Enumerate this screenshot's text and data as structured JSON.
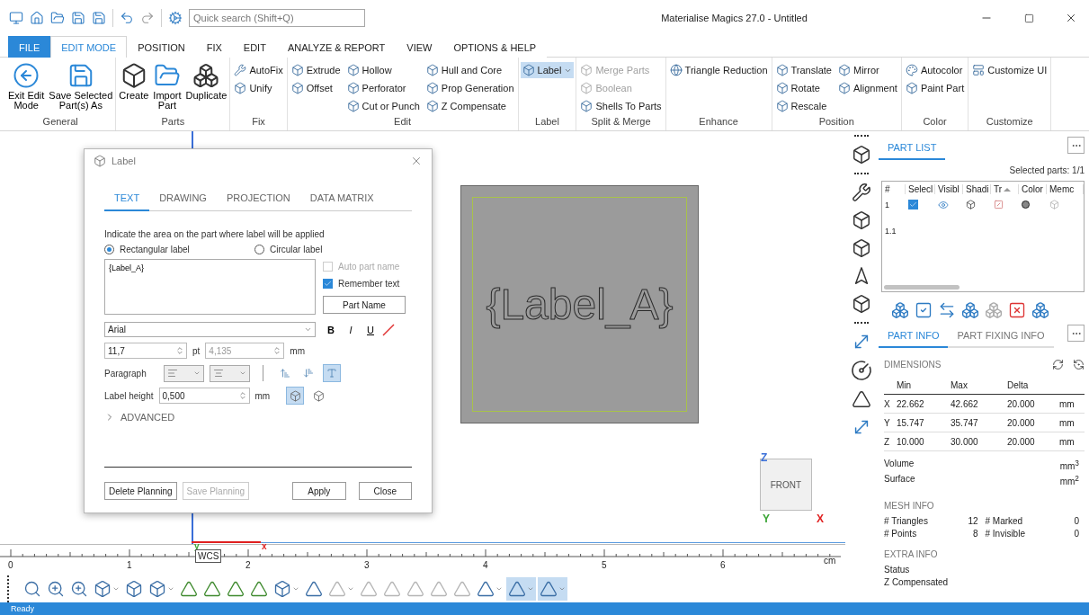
{
  "search": {
    "placeholder": "Quick search (Shift+Q)"
  },
  "window": {
    "title": "Materialise Magics 27.0 - Untitled"
  },
  "ribbon_tabs": [
    {
      "label": "FILE",
      "kind": "file",
      "selected": false
    },
    {
      "label": "EDIT MODE",
      "kind": "tab",
      "selected": true
    },
    {
      "label": "POSITION",
      "kind": "tab",
      "selected": false
    },
    {
      "label": "FIX",
      "kind": "tab",
      "selected": false
    },
    {
      "label": "EDIT",
      "kind": "tab",
      "selected": false
    },
    {
      "label": "ANALYZE & REPORT",
      "kind": "tab",
      "selected": false
    },
    {
      "label": "VIEW",
      "kind": "tab",
      "selected": false
    },
    {
      "label": "OPTIONS & HELP",
      "kind": "tab",
      "selected": false
    }
  ],
  "ribbon_groups": [
    {
      "name": "General",
      "kind": "large",
      "items": [
        {
          "label": "Exit Edit\nMode"
        },
        {
          "label": "Save Selected\nPart(s) As"
        }
      ]
    },
    {
      "name": "Parts",
      "kind": "large",
      "items": [
        {
          "label": "Create"
        },
        {
          "label": "Import\nPart"
        },
        {
          "label": "Duplicate"
        }
      ]
    },
    {
      "name": "Fix",
      "kind": "small",
      "columns": [
        [
          {
            "label": "AutoFix"
          },
          {
            "label": "Unify"
          }
        ]
      ]
    },
    {
      "name": "Edit",
      "kind": "small",
      "columns": [
        [
          {
            "label": "Extrude"
          },
          {
            "label": "Offset"
          }
        ],
        [
          {
            "label": "Hollow"
          },
          {
            "label": "Perforator"
          },
          {
            "label": "Cut or Punch"
          }
        ],
        [
          {
            "label": "Hull and Core"
          },
          {
            "label": "Prop Generation"
          },
          {
            "label": "Z Compensate"
          }
        ]
      ]
    },
    {
      "name": "Label",
      "kind": "small",
      "columns": [
        [
          {
            "label": "Label",
            "pressed": true,
            "dropdown": true
          }
        ]
      ]
    },
    {
      "name": "Split & Merge",
      "kind": "small",
      "columns": [
        [
          {
            "label": "Merge Parts",
            "disabled": true
          },
          {
            "label": "Boolean",
            "disabled": true
          },
          {
            "label": "Shells To Parts",
            "disabled": false
          }
        ]
      ]
    },
    {
      "name": "Enhance",
      "kind": "small",
      "columns": [
        [
          {
            "label": "Triangle Reduction"
          }
        ]
      ]
    },
    {
      "name": "Position",
      "kind": "small",
      "columns": [
        [
          {
            "label": "Translate"
          },
          {
            "label": "Rotate"
          },
          {
            "label": "Rescale"
          }
        ],
        [
          {
            "label": "Mirror"
          },
          {
            "label": "Alignment"
          }
        ]
      ]
    },
    {
      "name": "Color",
      "kind": "small",
      "columns": [
        [
          {
            "label": "Autocolor"
          },
          {
            "label": "Paint Part"
          }
        ]
      ]
    },
    {
      "name": "Customize",
      "kind": "small",
      "columns": [
        [
          {
            "label": "Customize UI"
          }
        ]
      ]
    }
  ],
  "viewport": {
    "part_label": "{Label_A}",
    "nav_cube": "FRONT",
    "axes": [
      {
        "label": "Z",
        "color": "#3a6fd8"
      },
      {
        "label": "Y",
        "color": "#3aa535"
      },
      {
        "label": "X",
        "color": "#e02020"
      }
    ]
  },
  "dialog": {
    "title": "Label",
    "tabs": [
      {
        "label": "TEXT",
        "selected": true
      },
      {
        "label": "DRAWING",
        "selected": false
      },
      {
        "label": "PROJECTION",
        "selected": false
      },
      {
        "label": "DATA MATRIX",
        "selected": false
      }
    ],
    "instruction": "Indicate the area on the part where label will be applied",
    "shape_options": [
      {
        "label": "Rectangular label",
        "selected": true
      },
      {
        "label": "Circular label",
        "selected": false
      }
    ],
    "label_text": "{Label_A}",
    "options": [
      {
        "label": "Auto part name",
        "checked": false,
        "disabled": true
      },
      {
        "label": "Remember text",
        "checked": true,
        "disabled": false
      }
    ],
    "part_name_button": "Part Name",
    "font": "Arial",
    "format_buttons": [
      "B",
      "I",
      "U"
    ],
    "font_size": {
      "value": "11,7",
      "unit": "pt",
      "disabled": false
    },
    "font_height": {
      "value": "4,135",
      "unit": "mm",
      "disabled": true
    },
    "paragraph_label": "Paragraph",
    "orientation_toggles": [
      {
        "selected": false
      },
      {
        "selected": false
      },
      {
        "selected": true
      }
    ],
    "label_height": {
      "label": "Label height",
      "value": "0,500",
      "unit": "mm"
    },
    "surface_toggles": [
      {
        "selected": true
      },
      {
        "selected": false
      }
    ],
    "advanced": {
      "label": "ADVANCED",
      "expanded": false
    },
    "buttons": [
      {
        "label": "Delete Planning",
        "disabled": false
      },
      {
        "label": "Save Planning",
        "disabled": true
      },
      {
        "label": "Apply",
        "disabled": false
      },
      {
        "label": "Close",
        "disabled": false
      }
    ]
  },
  "ruler": {
    "ticks": [
      "0",
      "1",
      "2",
      "3",
      "4",
      "5",
      "6"
    ],
    "unit": "cm",
    "origin_tag": "WCS",
    "origin_marks": [
      {
        "label": "y",
        "color": "#3aa535"
      },
      {
        "label": "x",
        "color": "#e02020"
      }
    ]
  },
  "view_toolbar": [
    {
      "selected": false,
      "disabled": false,
      "dropdown": false
    },
    {
      "selected": false,
      "disabled": false,
      "dropdown": false
    },
    {
      "selected": false,
      "disabled": false,
      "dropdown": false
    },
    {
      "selected": false,
      "disabled": false,
      "dropdown": true
    },
    {
      "selected": false,
      "disabled": false,
      "dropdown": false
    },
    {
      "selected": false,
      "disabled": false,
      "dropdown": true
    },
    {
      "selected": false,
      "disabled": false,
      "dropdown": false
    },
    {
      "selected": false,
      "disabled": false,
      "dropdown": false
    },
    {
      "selected": false,
      "disabled": false,
      "dropdown": false
    },
    {
      "selected": false,
      "disabled": false,
      "dropdown": false
    },
    {
      "selected": false,
      "disabled": false,
      "dropdown": true
    },
    {
      "selected": false,
      "disabled": false,
      "dropdown": false
    },
    {
      "selected": false,
      "disabled": true,
      "dropdown": true
    },
    {
      "selected": false,
      "disabled": true,
      "dropdown": false
    },
    {
      "selected": false,
      "disabled": true,
      "dropdown": false
    },
    {
      "selected": false,
      "disabled": true,
      "dropdown": false
    },
    {
      "selected": false,
      "disabled": true,
      "dropdown": false
    },
    {
      "selected": false,
      "disabled": true,
      "dropdown": false
    },
    {
      "selected": false,
      "disabled": false,
      "dropdown": true
    },
    {
      "selected": true,
      "disabled": false,
      "dropdown": true
    },
    {
      "selected": true,
      "disabled": false,
      "dropdown": true
    }
  ],
  "part_list": {
    "title": "PART LIST",
    "selected_info": "Selected parts: 1/1",
    "columns": [
      "#",
      "Selecl",
      "Visibl",
      "Shadi",
      "Tr",
      "Color",
      "Memc"
    ],
    "rows": [
      {
        "id": "1",
        "kind": "part",
        "checked": true
      },
      {
        "id": "1.1",
        "kind": "shell"
      }
    ]
  },
  "part_info": {
    "tabs": [
      {
        "label": "PART INFO",
        "selected": true
      },
      {
        "label": "PART FIXING INFO",
        "selected": false
      }
    ],
    "dimensions": {
      "title": "DIMENSIONS",
      "columns": [
        "Min",
        "Max",
        "Delta"
      ],
      "rows": [
        {
          "axis": "X",
          "min": "22.662",
          "max": "42.662",
          "delta": "20.000",
          "unit": "mm"
        },
        {
          "axis": "Y",
          "min": "15.747",
          "max": "35.747",
          "delta": "20.000",
          "unit": "mm"
        },
        {
          "axis": "Z",
          "min": "10.000",
          "max": "30.000",
          "delta": "20.000",
          "unit": "mm"
        }
      ],
      "extras": [
        {
          "label": "Volume",
          "unit": "mm$^{3}$"
        },
        {
          "label": "Surface",
          "unit": "mm$^{2}$"
        }
      ]
    },
    "mesh_info": {
      "title": "MESH INFO",
      "items": [
        {
          "label": "# Triangles",
          "value": "12"
        },
        {
          "label": "# Marked",
          "value": "0"
        },
        {
          "label": "# Points",
          "value": "8"
        },
        {
          "label": "# Invisible",
          "value": "0"
        }
      ]
    },
    "extra_info": {
      "title": "EXTRA INFO",
      "items": [
        "Status",
        "Z Compensated"
      ]
    }
  },
  "status_bar": {
    "text": "Ready"
  }
}
